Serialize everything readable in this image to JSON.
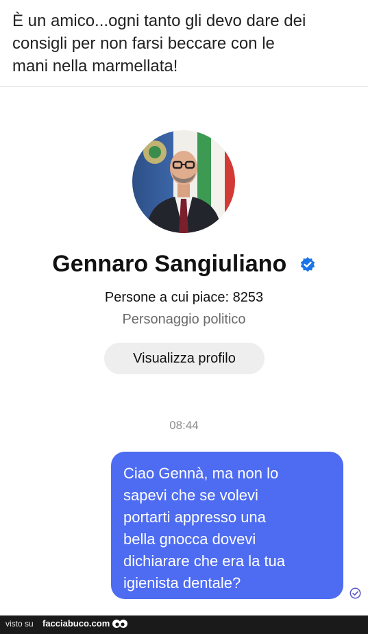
{
  "caption": {
    "lines": [
      "È un amico...ogni tanto gli devo dare dei",
      "consigli per non farsi beccare con le",
      "mani nella marmellata!"
    ]
  },
  "profile": {
    "name": "Gennaro Sangiuliano",
    "likes": "Persone a cui piace: 8253",
    "category": "Personaggio politico",
    "view_button": "Visualizza profilo",
    "verified_icon": "verified-badge-icon"
  },
  "chat": {
    "timestamp": "08:44",
    "message_lines": [
      "Ciao Gennà, ma non lo",
      "sapevi che se volevi",
      "portarti appresso una",
      "bella gnocca dovevi",
      "dichiarare che era la tua",
      "igienista dentale?"
    ],
    "bubble_color": "#4e6cf1",
    "status_icon": "seen-check-icon"
  },
  "footer": {
    "prefix": "visto su",
    "site": "facciabuco.com"
  }
}
